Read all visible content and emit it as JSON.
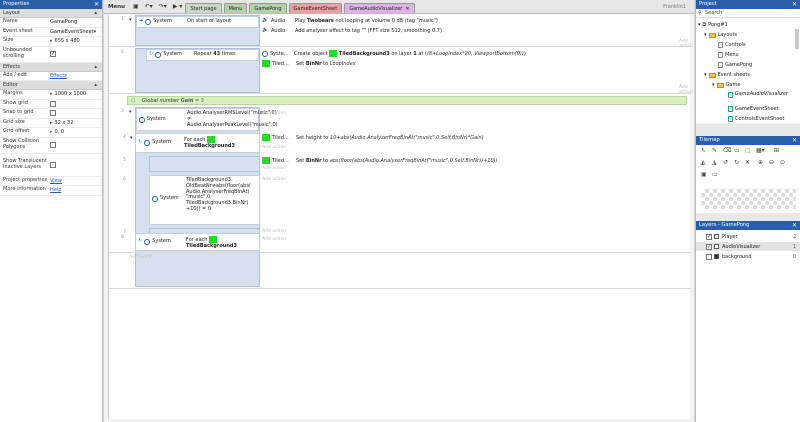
{
  "properties": {
    "title": "Properties",
    "sections": {
      "layout": "Layout",
      "effects": "Effects",
      "editor": "Editor"
    },
    "layout_rows": [
      {
        "key": "Name",
        "value": "GamePong"
      },
      {
        "key": "Event sheet",
        "value": "GameEventSheet"
      },
      {
        "key": "Size",
        "value": "655 x 480"
      }
    ],
    "unbounded_label": "Unbounded scrolling",
    "effects_row": {
      "key": "Add / edit",
      "value": "Effects"
    },
    "margins": {
      "key": "Margins",
      "value": "1000 x 1000"
    },
    "show_grid": "Show grid",
    "snap_to_grid": "Snap to grid",
    "grid_size": {
      "key": "Grid size",
      "value": "32 x 32"
    },
    "grid_offset": {
      "key": "Grid offset",
      "value": "0, 0"
    },
    "show_collision": "Show Collision Polygons",
    "show_translucent": "Show Translucent Inactive Layers",
    "project_properties": {
      "key": "Project properties",
      "value": "View"
    },
    "more_information": {
      "key": "More information",
      "value": "Help"
    }
  },
  "toolbar": {
    "menu": "Menu",
    "tabs": [
      {
        "label": "Start page",
        "color": "#c9d6c9"
      },
      {
        "label": "Menu",
        "color": "#b5d1a9"
      },
      {
        "label": "GamePong",
        "color": "#b5d1a9"
      },
      {
        "label": "GameEventSheet",
        "color": "#e8a0a0"
      },
      {
        "label": "GameAudioVisualizer",
        "color": "#e0b0e8"
      }
    ],
    "active_tab_close": "✕",
    "user": "Franklin1"
  },
  "events": {
    "e1": {
      "num": "1",
      "cond_obj": "System",
      "cond_text": "On start of layout",
      "actions": [
        {
          "obj": "Audio",
          "pre": "Play ",
          "bold": "Twobears",
          "post": " not looping at volume 0 dB (tag \"music\")"
        },
        {
          "obj": "Audio",
          "pre": "Add analyser effect to tag \"\" (FFT size 512, smoothing 0.7)",
          "bold": "",
          "post": ""
        }
      ]
    },
    "e2": {
      "num": "2",
      "cond_obj": "System",
      "cond_pre": "Repeat ",
      "cond_bold": "43",
      "cond_post": " times",
      "a1_obj": "Syste...",
      "a1_pre": "Create object ",
      "a1_bold": "TiledBackground3",
      "a1_mid": " on layer ",
      "a1_bold2": "1",
      "a1_post": " at (",
      "a1_italic": "(8+LoopIndex*20, ViewportBottom(0))",
      "a1_end": ")",
      "a2_obj": "Tiled...",
      "a2_pre": "Set ",
      "a2_bold": "BinNr",
      "a2_post": " to ",
      "a2_italic": "LoopIndex"
    },
    "gvar": {
      "pre": "Global number ",
      "bold": "Gain",
      "post": " = 3"
    },
    "e3": {
      "num": "3",
      "cond_obj": "System",
      "cond_text": "Audio.AnalyserRMSLevel(\"music\",0) ≠ Audio.AnalyserPeakLevel(\"music\",0)"
    },
    "e4": {
      "num": "4",
      "cond_obj": "System",
      "cond_text": "For each",
      "cond_bold": "TiledBackground3",
      "a_obj": "Tiled...",
      "a_pre": "Set height to ",
      "a_italic": "10+abs(Audio.AnalyserFreqBinAt(\"music\",0,Self.BinNr)*Gain)"
    },
    "e5": {
      "num": "5",
      "a_obj": "Tiled...",
      "a_pre": "Set ",
      "a_bold": "BinNr",
      "a_post": " to ",
      "a_italic": "abs(floor(abs(Audio.AnalyserFreqBinAt(\"music\",0,Self.BinNr))+10))"
    },
    "e6": {
      "num": "6",
      "cond_obj": "System",
      "cond_text": "TiledBackground3. OldBeatNr≠abs(floor(abs( Audio.AnalyserFreqBinAt( \"music\",0, TiledBackground3.BinNr) +10)) = 0"
    },
    "e7": {
      "num": "7"
    },
    "e8": {
      "num": "8",
      "cond_obj": "System",
      "cond_text": "For each",
      "cond_bold": "TiledBackground3"
    },
    "add_action": "Add action",
    "add_event": "Add event"
  },
  "project": {
    "title": "Project",
    "search": "Search",
    "items": {
      "root": "Pong#1",
      "layouts": "Layouts",
      "controls": "Controls",
      "menu": "Menu",
      "gamepong": "GamePong",
      "event_sheets": "Event sheets",
      "game": "Game",
      "gav": "GameAudioVisualizer",
      "ges": "GameEventSheet",
      "ces": "ControlsEventSheet"
    }
  },
  "tilemap": {
    "title": "Tilemap"
  },
  "layers": {
    "title": "Layers - GamePong",
    "rows": [
      {
        "name": "Player",
        "count": "2"
      },
      {
        "name": "AudioVisualizer",
        "count": "1"
      },
      {
        "name": "background",
        "count": "0"
      }
    ]
  }
}
